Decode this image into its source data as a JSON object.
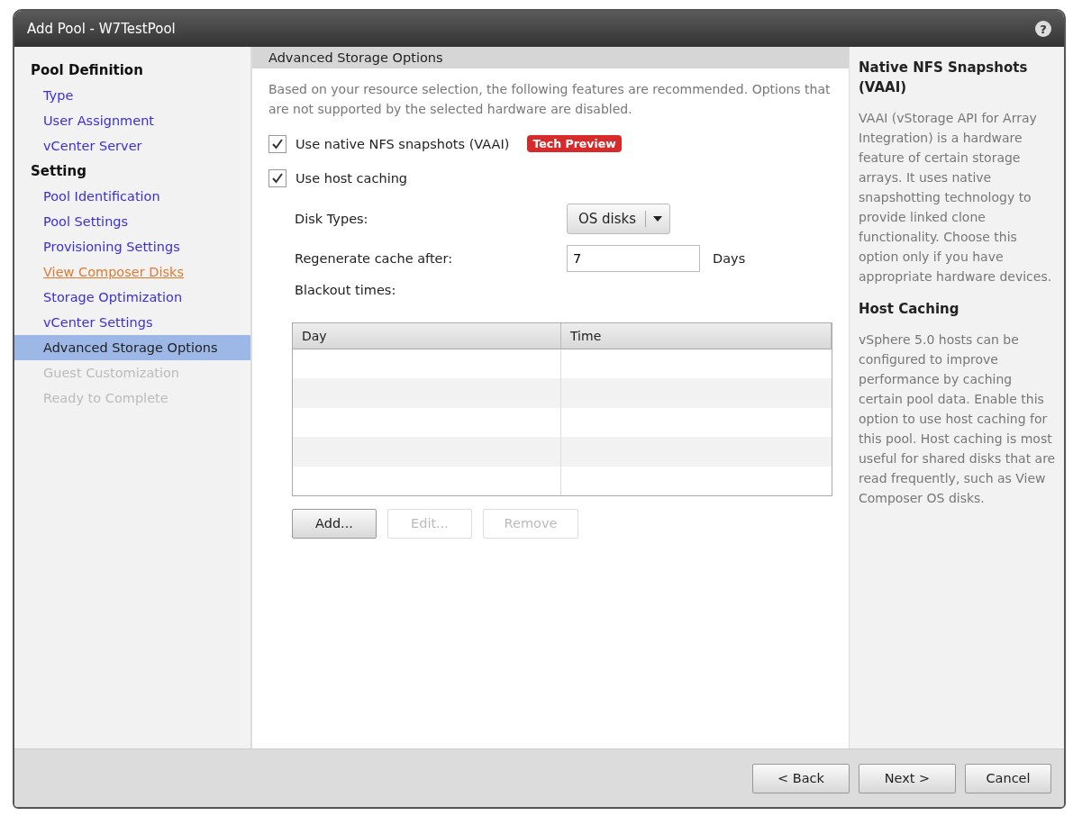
{
  "window": {
    "title": "Add Pool - W7TestPool",
    "help": "?"
  },
  "nav": [
    {
      "kind": "heading",
      "label": "Pool Definition"
    },
    {
      "kind": "link",
      "label": "Type",
      "selected": false,
      "disabled": false,
      "visited": false
    },
    {
      "kind": "link",
      "label": "User Assignment",
      "selected": false,
      "disabled": false,
      "visited": false
    },
    {
      "kind": "link",
      "label": "vCenter Server",
      "selected": false,
      "disabled": false,
      "visited": false
    },
    {
      "kind": "heading",
      "label": "Setting"
    },
    {
      "kind": "link",
      "label": "Pool Identification",
      "selected": false,
      "disabled": false,
      "visited": false
    },
    {
      "kind": "link",
      "label": "Pool Settings",
      "selected": false,
      "disabled": false,
      "visited": false
    },
    {
      "kind": "link",
      "label": "Provisioning Settings",
      "selected": false,
      "disabled": false,
      "visited": false
    },
    {
      "kind": "link",
      "label": "View Composer Disks",
      "selected": false,
      "disabled": false,
      "visited": true
    },
    {
      "kind": "link",
      "label": "Storage Optimization",
      "selected": false,
      "disabled": false,
      "visited": false
    },
    {
      "kind": "link",
      "label": "vCenter Settings",
      "selected": false,
      "disabled": false,
      "visited": false
    },
    {
      "kind": "link",
      "label": "Advanced Storage Options",
      "selected": true,
      "disabled": false,
      "visited": false
    },
    {
      "kind": "link",
      "label": "Guest Customization",
      "selected": false,
      "disabled": true,
      "visited": false
    },
    {
      "kind": "link",
      "label": "Ready to Complete",
      "selected": false,
      "disabled": true,
      "visited": false
    }
  ],
  "content": {
    "heading": "Advanced Storage Options",
    "intro": "Based on your resource selection, the following features are recommended. Options that are not supported by the selected hardware are disabled.",
    "options": [
      {
        "label": "Use native NFS snapshots (VAAI)",
        "checked": true,
        "badge": "Tech Preview"
      },
      {
        "label": "Use host caching",
        "checked": true
      }
    ],
    "disk_types": {
      "label": "Disk Types:",
      "value": "OS disks"
    },
    "regenerate": {
      "label": "Regenerate cache after:",
      "value": "7",
      "unit": "Days"
    },
    "blackout": {
      "label": "Blackout times:",
      "columns": [
        "Day",
        "Time"
      ]
    },
    "buttons": [
      {
        "label": "Add...",
        "disabled": false
      },
      {
        "label": "Edit...",
        "disabled": true
      },
      {
        "label": "Remove",
        "disabled": true
      }
    ]
  },
  "help": [
    {
      "title": "Native NFS Snapshots (VAAI)",
      "text": "VAAI (vStorage API for Array Integration) is a hardware feature of certain storage arrays. It uses native snapshotting technology to provide linked clone functionality. Choose this option only if you have appropriate hardware devices."
    },
    {
      "title": "Host Caching",
      "text": "vSphere 5.0 hosts can be configured to improve performance by caching certain pool data. Enable this option to use host caching for this pool. Host caching is most useful for shared disks that are read frequently, such as View Composer OS disks."
    }
  ],
  "footer": [
    {
      "label": "< Back"
    },
    {
      "label": "Next >"
    },
    {
      "label": "Cancel"
    }
  ]
}
